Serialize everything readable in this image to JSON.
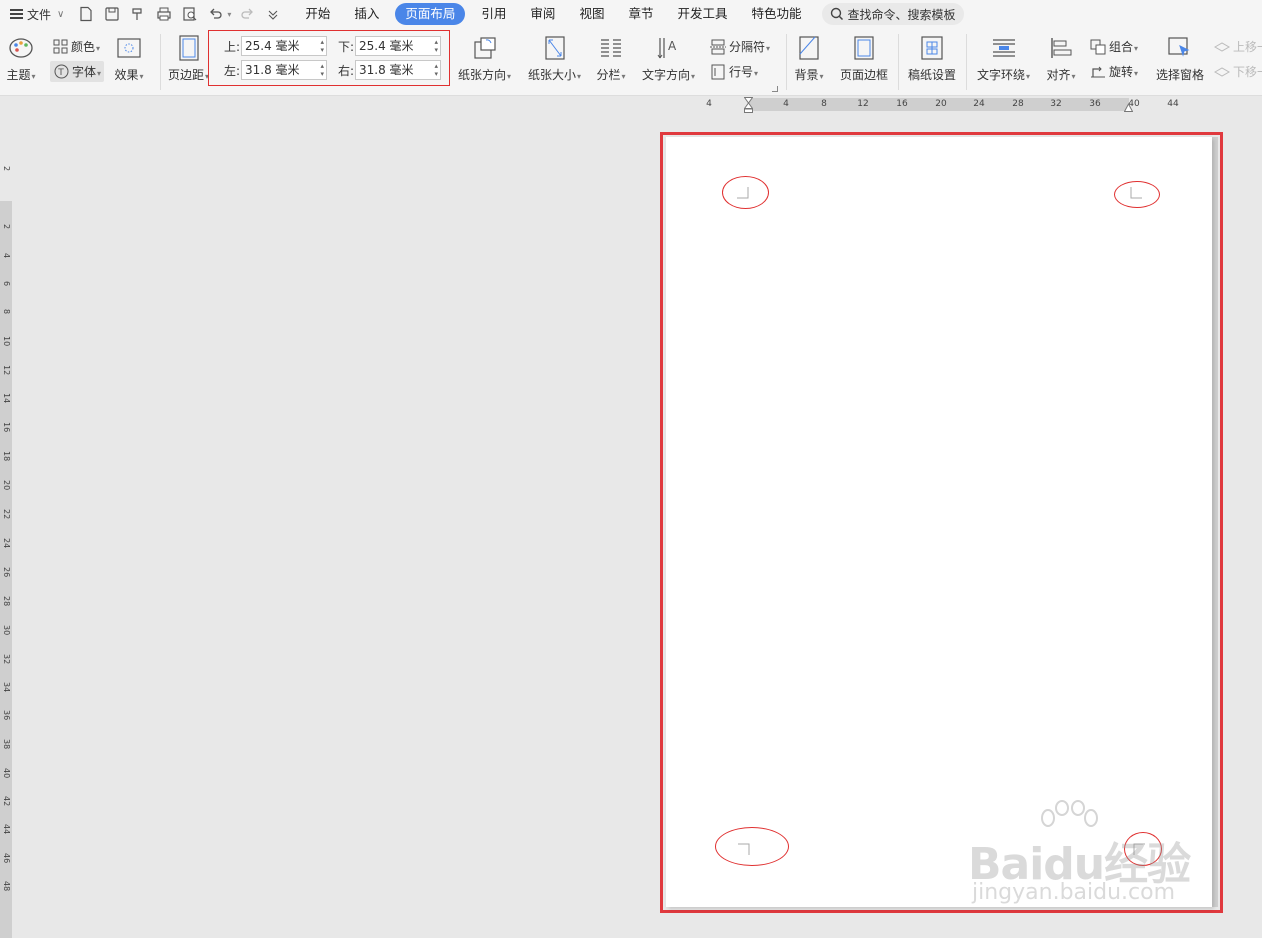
{
  "menubar": {
    "file_label": "文件",
    "tabs": [
      "开始",
      "插入",
      "页面布局",
      "引用",
      "审阅",
      "视图",
      "章节",
      "开发工具",
      "特色功能"
    ],
    "active_tab": "页面布局",
    "search_placeholder": "查找命令、搜索模板"
  },
  "ribbon": {
    "theme": "主题",
    "colors": "颜色",
    "fonts": "字体",
    "effects": "效果",
    "margins": "页边距",
    "margin_fields": {
      "top_label": "上:",
      "top_value": "25.4 毫米",
      "bottom_label": "下:",
      "bottom_value": "25.4 毫米",
      "left_label": "左:",
      "left_value": "31.8 毫米",
      "right_label": "右:",
      "right_value": "31.8 毫米"
    },
    "orientation": "纸张方向",
    "size": "纸张大小",
    "columns": "分栏",
    "text_direction": "文字方向",
    "breaks": "分隔符",
    "line_numbers": "行号",
    "background": "背景",
    "page_border": "页面边框",
    "manuscript": "稿纸设置",
    "wrap_text": "文字环绕",
    "align": "对齐",
    "group": "组合",
    "rotate": "旋转",
    "selection_pane": "选择窗格",
    "bring_forward": "上移一",
    "send_backward": "下移一"
  },
  "hruler": {
    "ticks": [
      "4",
      "4",
      "8",
      "12",
      "16",
      "20",
      "24",
      "28",
      "32",
      "36",
      "40",
      "44"
    ]
  },
  "vruler": {
    "ticks": [
      "2",
      "2",
      "4",
      "6",
      "8",
      "10",
      "12",
      "14",
      "16",
      "18",
      "20",
      "22",
      "24",
      "26",
      "28",
      "30",
      "32",
      "34",
      "36",
      "38",
      "40",
      "42",
      "44",
      "46",
      "48"
    ]
  },
  "watermark": {
    "line1": "Baidu经验",
    "line2": "jingyan.baidu.com"
  },
  "colors": {
    "accent": "#4a86e8",
    "highlight_red": "#e03030"
  }
}
